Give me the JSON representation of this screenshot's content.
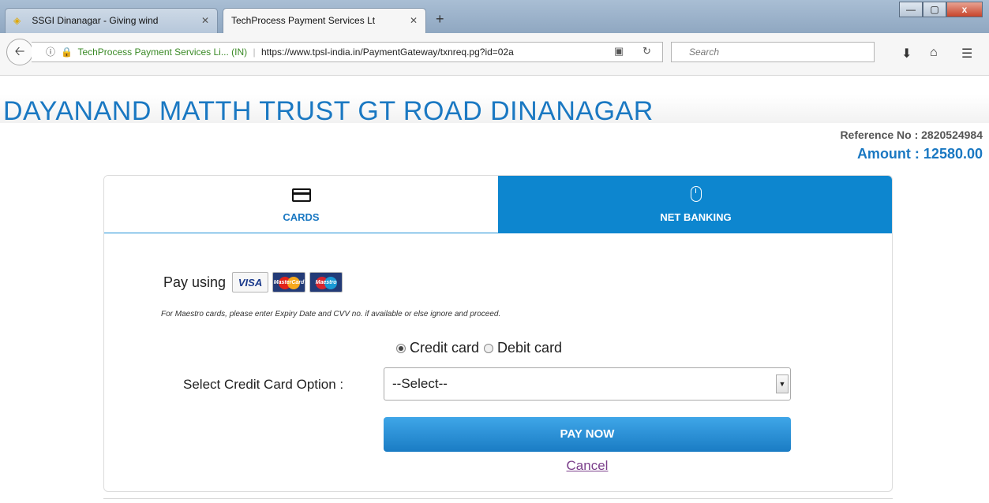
{
  "browser": {
    "tabs": [
      {
        "title": "SSGI Dinanagar - Giving wind",
        "active": false
      },
      {
        "title": "TechProcess Payment Services Lt",
        "active": true
      }
    ],
    "new_tab_label": "+",
    "window_controls": {
      "minimize": "—",
      "maximize": "▢",
      "close": "x"
    },
    "site_identity": "TechProcess Payment Services Li... (IN)",
    "url": "https://www.tpsl-india.in/PaymentGateway/txnreq.pg?id=02a",
    "search_placeholder": "Search",
    "icons": [
      "back-icon",
      "info-icon",
      "lock-icon",
      "reader-view-icon",
      "reload-icon",
      "search-icon",
      "download-icon",
      "home-icon",
      "menu-icon"
    ]
  },
  "page": {
    "merchant_name": "DAYANAND MATTH TRUST GT ROAD DINANAGAR",
    "reference": "Reference No : 2820524984",
    "amount": "Amount : 12580.00",
    "tabs": [
      {
        "label": "CARDS",
        "icon": "card-icon",
        "selected": true
      },
      {
        "label": "NET BANKING",
        "icon": "mouse-icon",
        "selected": false
      }
    ],
    "pay_using_label": "Pay using",
    "card_logos": [
      "VISA",
      "MasterCard",
      "Maestro"
    ],
    "maestro_note": "For Maestro cards, please enter Expiry Date and CVV no. if available or else ignore and proceed.",
    "card_type_options": [
      {
        "label": "Credit card",
        "checked": true
      },
      {
        "label": "Debit card",
        "checked": false
      }
    ],
    "select_label": "Select Credit Card Option :",
    "select_value": "--Select--",
    "pay_button": "PAY NOW",
    "cancel_link": "Cancel"
  },
  "colors": {
    "brand_blue": "#1a78c2",
    "net_banking_tab": "#0d86cf",
    "pay_button": "#2a90d6",
    "cancel_link": "#7b3f8b"
  }
}
